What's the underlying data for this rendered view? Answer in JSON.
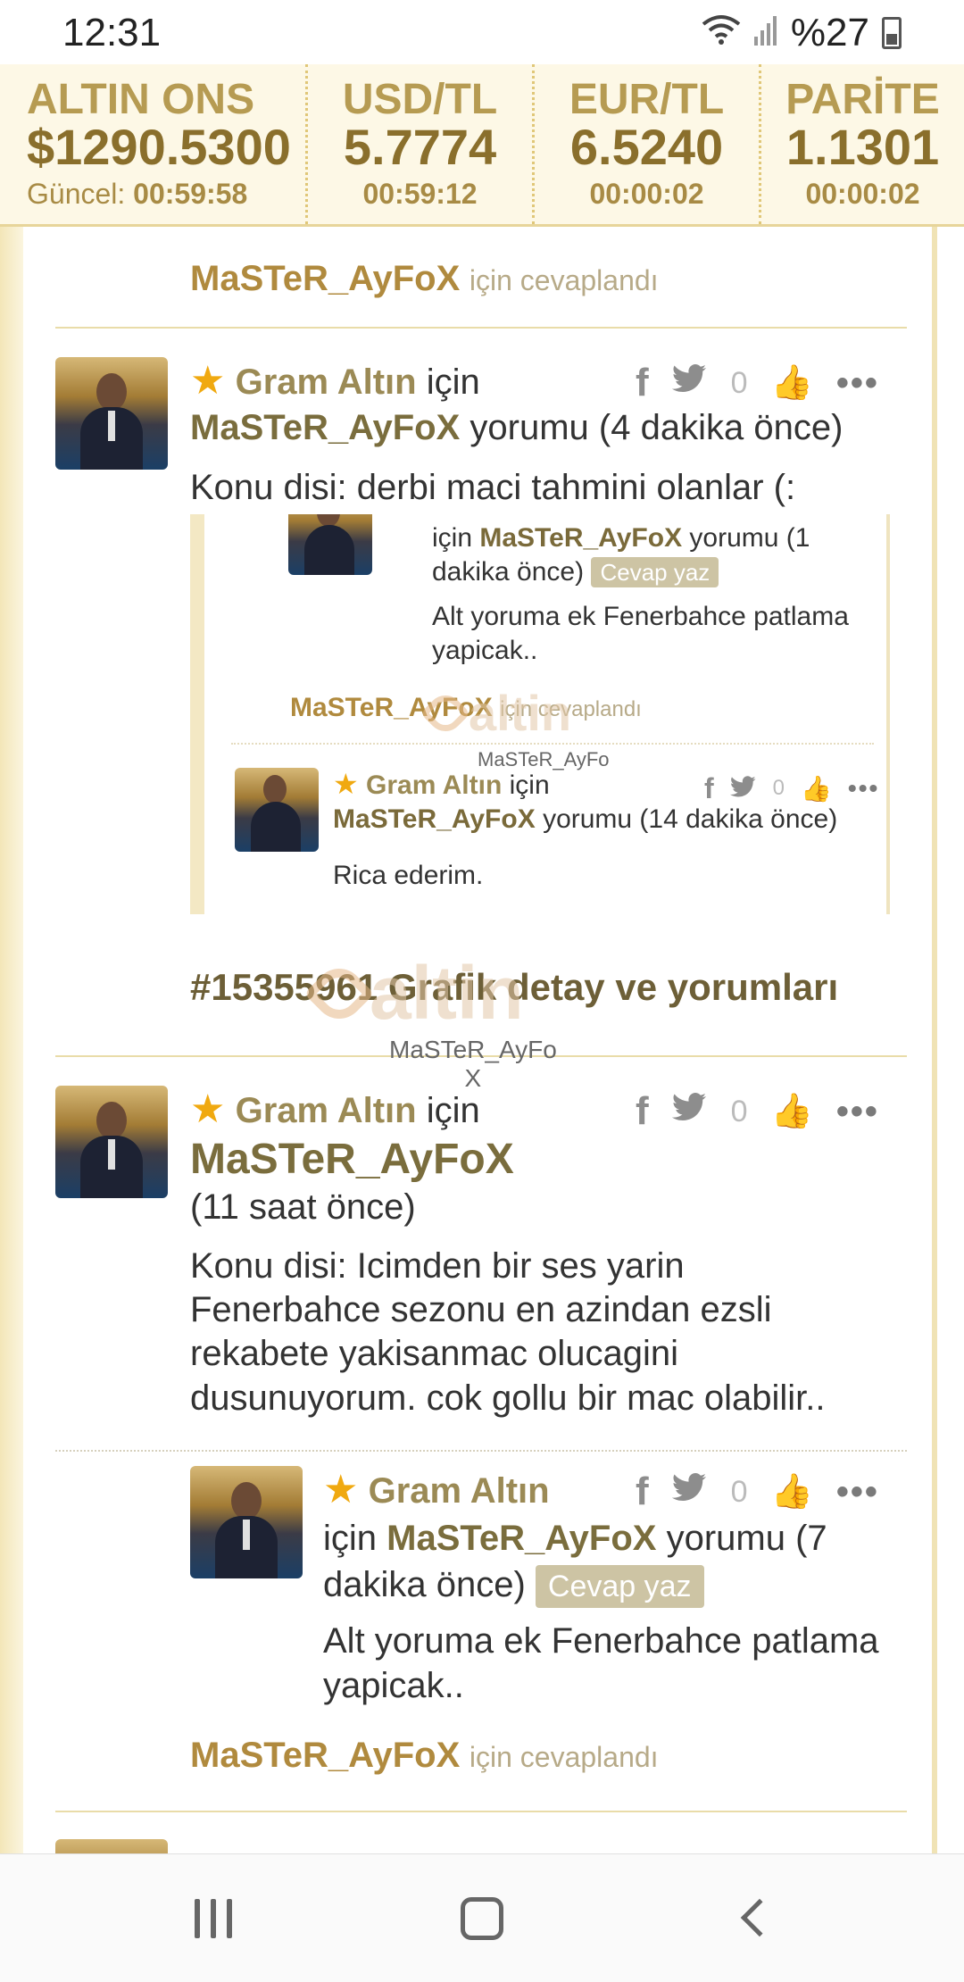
{
  "status": {
    "time": "12:31",
    "battery": "%27"
  },
  "ticker": [
    {
      "label": "ALTIN ONS",
      "value": "$1290.5300",
      "prefix": "Güncel:",
      "time": "00:59:58"
    },
    {
      "label": "USD/TL",
      "value": "5.7774",
      "time": "00:59:12"
    },
    {
      "label": "EUR/TL",
      "value": "6.5240",
      "time": "00:00:02"
    },
    {
      "label": "PARİTE",
      "value": "1.1301",
      "time": "00:00:02"
    }
  ],
  "replied_top": {
    "name": "MaSTeR_AyFoX",
    "suffix": "için cevaplandı"
  },
  "comment1": {
    "subject": "Gram Altın",
    "for": "için",
    "user": "MaSTeR_AyFoX",
    "meta": "yorumu (4 dakika önce)",
    "likes": "0",
    "text": "Konu disi: derbi maci tahmini olanlar (:"
  },
  "embed": {
    "reply1_for": "için",
    "reply1_user": "MaSTeR_AyFoX",
    "reply1_meta_a": "yorumu (1",
    "reply1_meta_b": "dakika önce)",
    "reply_btn": "Cevap yaz",
    "reply1_text_a": "Alt yoruma ek Fenerbahce patlama",
    "reply1_text_b": "yapicak..",
    "replied_name": "MaSTeR_AyFoX",
    "replied_suffix": "için cevaplandı",
    "wm_text": "altin",
    "wm_caption": "MaSTeR_AyFo",
    "reply2_subject": "Gram Altın",
    "reply2_for": "için",
    "reply2_user": "MaSTeR_AyFoX",
    "reply2_meta": "yorumu (14 dakika önce)",
    "reply2_likes": "0",
    "reply2_text": "Rica ederim."
  },
  "section": {
    "title": "#15355961 Grafik detay ve yorumları",
    "wm_text": "altin",
    "wm_caption_a": "MaSTeR_AyFo",
    "wm_caption_b": "X"
  },
  "comment2": {
    "subject": "Gram Altın",
    "for": "için",
    "user": "MaSTeR_AyFoX",
    "meta": "(11 saat önce)",
    "likes": "0",
    "text_lines": [
      "Konu disi: Icimden bir ses yarin",
      "Fenerbahce sezonu en azindan ezsli",
      "rekabete yakisanmac olucagini",
      "dusunuyorum. cok gollu bir mac olabilir.."
    ]
  },
  "reply": {
    "subject": "Gram Altın",
    "for": "için",
    "user": "MaSTeR_AyFoX",
    "meta_a": "yorumu (7",
    "meta_b": "dakika önce)",
    "reply_btn": "Cevap yaz",
    "likes": "0",
    "text_a": "Alt yoruma ek Fenerbahce patlama",
    "text_b": "yapicak.."
  },
  "replied_bottom": {
    "name": "MaSTeR_AyFoX",
    "suffix": "için cevaplandı"
  },
  "icons": {
    "facebook": "facebook-icon",
    "twitter": "twitter-icon",
    "like": "thumbs-up-icon",
    "more": "more-icon",
    "star": "star-icon"
  }
}
